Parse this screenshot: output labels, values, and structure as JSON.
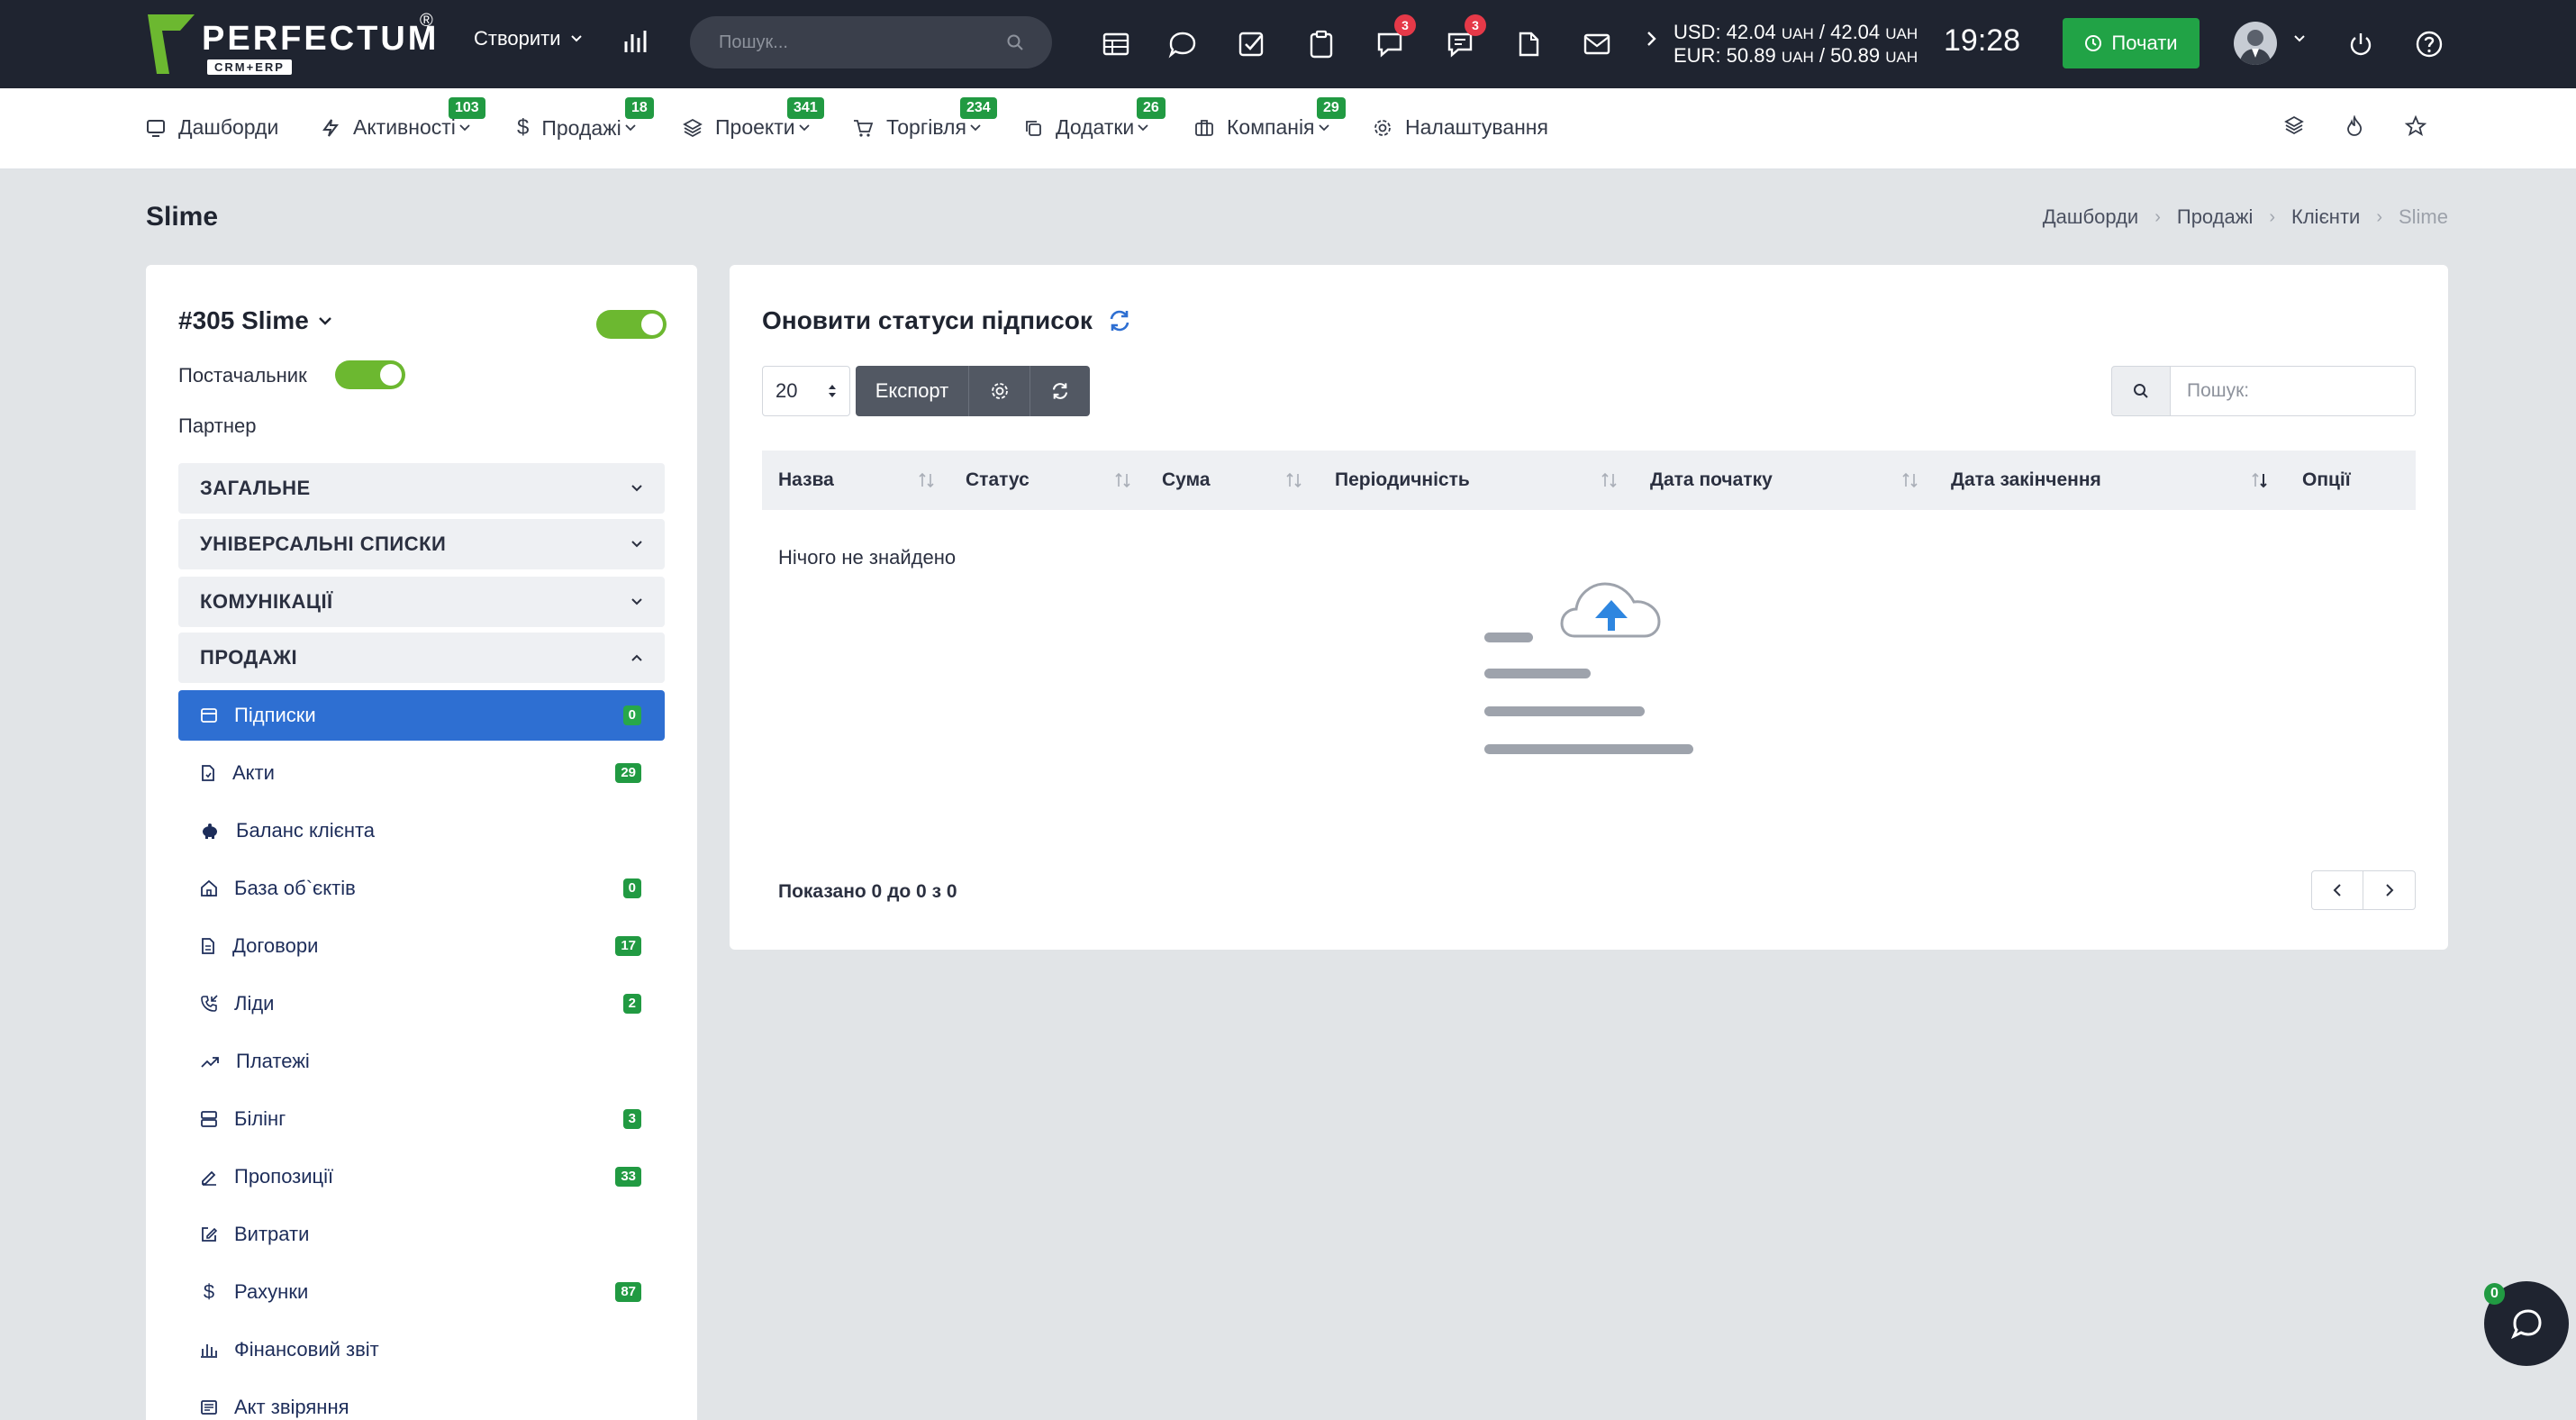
{
  "app": {
    "logo_text": "PERFECTUM",
    "logo_sub": "CRM+ERP",
    "logo_reg": "®"
  },
  "topbar": {
    "create_label": "Створити",
    "search_placeholder": "Пошук...",
    "notif_badges": {
      "chat": "3",
      "messages": "3"
    },
    "rates": {
      "usd": "USD: 42.04",
      "usd_unit": "UAH",
      "usd_sep": " / 42.04 ",
      "eur": "EUR: 50.89",
      "eur_unit": "UAH",
      "eur_sep": " / 50.89 "
    },
    "clock": "19:28",
    "start_label": "Почати"
  },
  "nav": {
    "items": [
      {
        "label": "Дашборди",
        "badge": ""
      },
      {
        "label": "Активності",
        "badge": "103"
      },
      {
        "label": "Продажі",
        "badge": "18"
      },
      {
        "label": "Проекти",
        "badge": "341"
      },
      {
        "label": "Торгівля",
        "badge": "234"
      },
      {
        "label": "Додатки",
        "badge": "26"
      },
      {
        "label": "Компанія",
        "badge": "29"
      },
      {
        "label": "Налаштування",
        "badge": ""
      }
    ]
  },
  "page": {
    "title": "Slime",
    "breadcrumb": [
      "Дашборди",
      "Продажі",
      "Клієнти",
      "Slime"
    ]
  },
  "client": {
    "name": "#305 Slime",
    "supplier_label": "Постачальник",
    "partner_label": "Партнер",
    "sections": [
      "ЗАГАЛЬНЕ",
      "УНІВЕРСАЛЬНІ СПИСКИ",
      "КОМУНІКАЦІЇ",
      "ПРОДАЖІ"
    ],
    "menu": [
      {
        "label": "Підписки",
        "count": "0"
      },
      {
        "label": "Акти",
        "count": "29"
      },
      {
        "label": "Баланс клієнта",
        "count": ""
      },
      {
        "label": "База об`єктів",
        "count": "0"
      },
      {
        "label": "Договори",
        "count": "17"
      },
      {
        "label": "Ліди",
        "count": "2"
      },
      {
        "label": "Платежі",
        "count": ""
      },
      {
        "label": "Білінг",
        "count": "3"
      },
      {
        "label": "Пропозиції",
        "count": "33"
      },
      {
        "label": "Витрати",
        "count": ""
      },
      {
        "label": "Рахунки",
        "count": "87"
      },
      {
        "label": "Фінансовий звіт",
        "count": ""
      },
      {
        "label": "Акт звіряння",
        "count": ""
      }
    ]
  },
  "main": {
    "title": "Оновити статуси підписок",
    "page_size": "20",
    "export_label": "Експорт",
    "search_placeholder": "Пошук:",
    "columns": [
      "Назва",
      "Статус",
      "Сума",
      "Періодичність",
      "Дата початку",
      "Дата закінчення",
      "Опції"
    ],
    "empty_text": "Нічого не знайдено",
    "shown_text": "Показано 0 до 0 з 0"
  },
  "chat": {
    "badge": "0"
  },
  "colors": {
    "topbar": "#1f2430",
    "accent_green": "#21a346",
    "active_blue": "#2e6fd2",
    "badge_red": "#e53948"
  }
}
